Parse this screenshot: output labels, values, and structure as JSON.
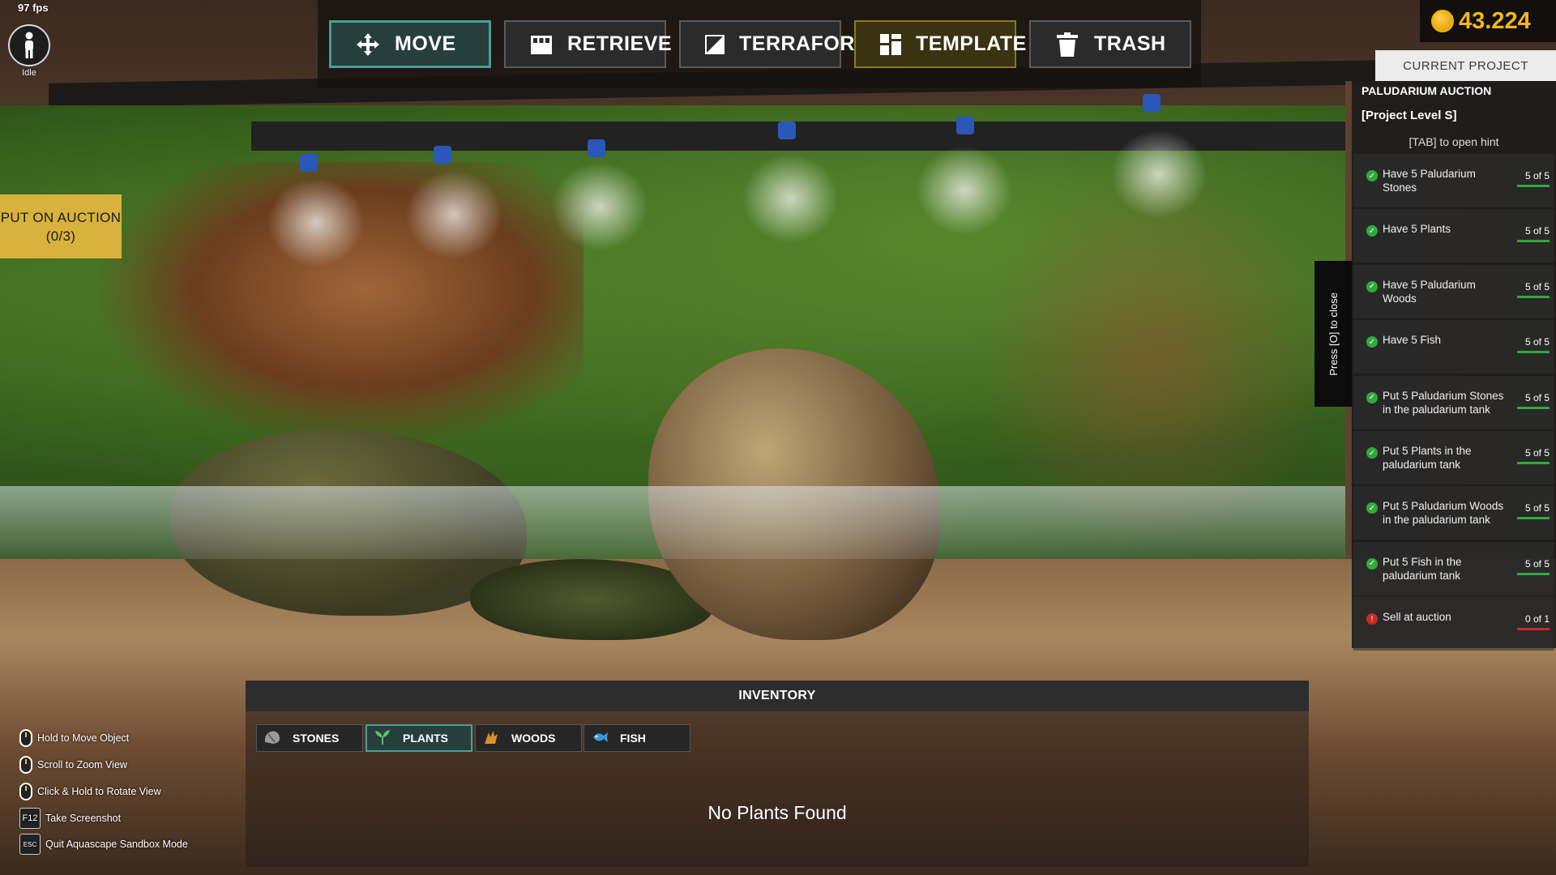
{
  "fps": "97 fps",
  "player": {
    "status": "Idle"
  },
  "toolbar": {
    "move": "MOVE",
    "retrieve": "RETRIEVE",
    "terraform": "TERRAFORM",
    "template": "TEMPLATE",
    "trash": "TRASH"
  },
  "coins": {
    "value": "43.224"
  },
  "auction_button": {
    "label": "PUT ON AUCTION (0/3)"
  },
  "project": {
    "tab": "CURRENT PROJECT",
    "title": "PALUDARIUM AUCTION",
    "level": "[Project Level S]",
    "hint": "[TAB] to open hint",
    "close_hint": "Press [O] to close",
    "tasks": [
      {
        "text": "Have 5 Paludarium Stones",
        "count": "5 of 5",
        "done": true
      },
      {
        "text": "Have 5 Plants",
        "count": "5 of 5",
        "done": true
      },
      {
        "text": "Have 5 Paludarium Woods",
        "count": "5 of 5",
        "done": true
      },
      {
        "text": "Have 5 Fish",
        "count": "5 of 5",
        "done": true
      },
      {
        "text": "Put 5 Paludarium Stones in the paludarium tank",
        "count": "5 of 5",
        "done": true
      },
      {
        "text": "Put 5 Plants in the paludarium tank",
        "count": "5 of 5",
        "done": true
      },
      {
        "text": "Put 5 Paludarium Woods in the paludarium tank",
        "count": "5 of 5",
        "done": true
      },
      {
        "text": "Put 5 Fish in the paludarium tank",
        "count": "5 of 5",
        "done": true
      },
      {
        "text": "Sell at auction",
        "count": "0 of 1",
        "done": false
      }
    ]
  },
  "inventory": {
    "title": "INVENTORY",
    "tabs": [
      {
        "label": "STONES",
        "icon": "stone-icon",
        "active": false
      },
      {
        "label": "PLANTS",
        "icon": "plant-icon",
        "active": true
      },
      {
        "label": "WOODS",
        "icon": "wood-icon",
        "active": false
      },
      {
        "label": "FISH",
        "icon": "fish-icon",
        "active": false
      }
    ],
    "empty_message": "No Plants Found"
  },
  "controls": [
    {
      "icon": "mouse-icon",
      "label": "Hold to Move Object"
    },
    {
      "icon": "mouse-icon",
      "label": "Scroll to Zoom View"
    },
    {
      "icon": "mouse-icon",
      "label": "Click & Hold to Rotate View"
    },
    {
      "key": "F12",
      "label": "Take Screenshot"
    },
    {
      "key": "ESC",
      "label": "Quit Aquascape Sandbox Mode"
    }
  ],
  "colors": {
    "accent_teal": "#4a9e95",
    "coin_gold": "#f4b51c",
    "auction_yellow": "#d8b23c",
    "success_green": "#2faa3c",
    "fail_red": "#c82a2a"
  }
}
